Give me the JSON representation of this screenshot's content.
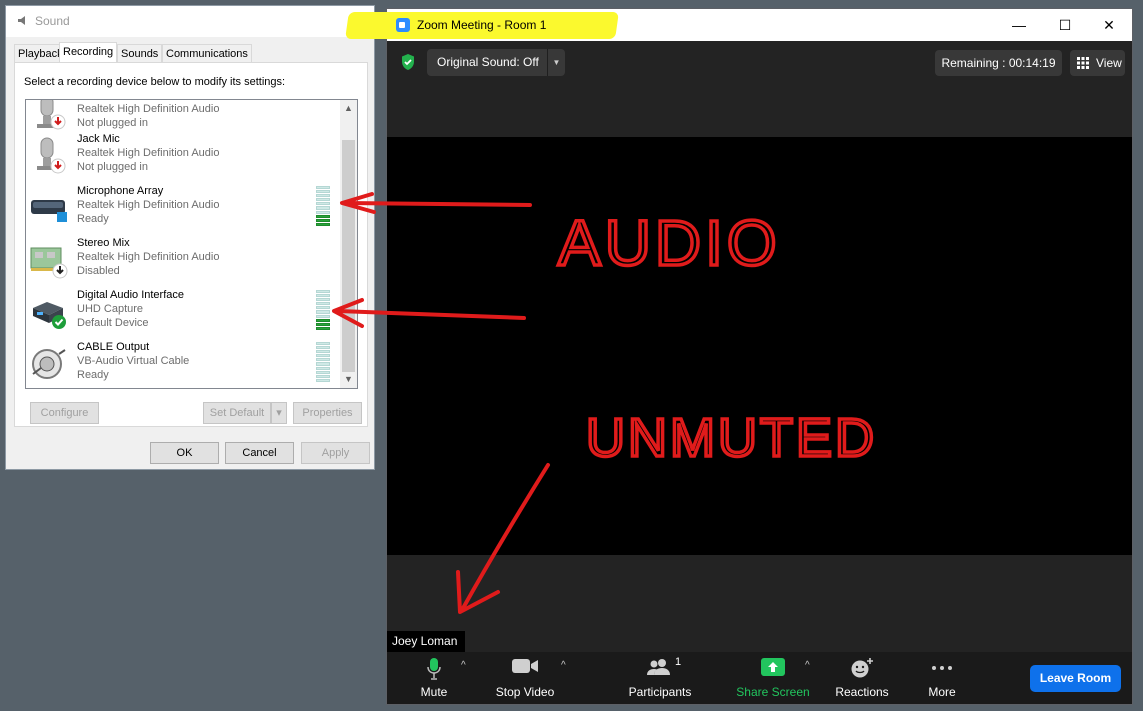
{
  "sound_dialog": {
    "title": "Sound",
    "close_glyph": "✕",
    "tabs": [
      "Playback",
      "Recording",
      "Sounds",
      "Communications"
    ],
    "active_tab": "Recording",
    "instruction": "Select a recording device below to modify its settings:",
    "devices": [
      {
        "name": "",
        "driver": "Realtek High Definition Audio",
        "status": "Not plugged in",
        "icon": "microphone-icon",
        "badge": "unplugged",
        "meter_level": null
      },
      {
        "name": "Jack Mic",
        "driver": "Realtek High Definition Audio",
        "status": "Not plugged in",
        "icon": "microphone-icon",
        "badge": "unplugged",
        "meter_level": null
      },
      {
        "name": "Microphone Array",
        "driver": "Realtek High Definition Audio",
        "status": "Ready",
        "icon": "microphone-array-icon",
        "badge": null,
        "meter_level": 0.3
      },
      {
        "name": "Stereo Mix",
        "driver": "Realtek High Definition Audio",
        "status": "Disabled",
        "icon": "sound-card-icon",
        "badge": "disabled",
        "meter_level": null
      },
      {
        "name": "Digital Audio Interface",
        "driver": "UHD Capture",
        "status": "Default Device",
        "icon": "audio-interface-icon",
        "badge": "default",
        "meter_level": 0.3
      },
      {
        "name": "CABLE Output",
        "driver": "VB-Audio Virtual Cable",
        "status": "Ready",
        "icon": "virtual-cable-icon",
        "badge": null,
        "meter_level": 0
      }
    ],
    "buttons": {
      "configure": "Configure",
      "set_default": "Set Default",
      "properties": "Properties",
      "ok": "OK",
      "cancel": "Cancel",
      "apply": "Apply"
    }
  },
  "zoom": {
    "title": "Zoom Meeting - Room 1",
    "window_controls": {
      "minimize": "—",
      "maximize": "☐",
      "close": "✕"
    },
    "original_sound": "Original Sound: Off",
    "remaining": "Remaining : 00:14:19",
    "view": "View",
    "participant_name": "Joey Loman",
    "toolbar": {
      "mute": "Mute",
      "stop_video": "Stop Video",
      "participants": "Participants",
      "participants_count": "1",
      "share_screen": "Share Screen",
      "reactions": "Reactions",
      "more": "More",
      "leave": "Leave Room"
    },
    "colors": {
      "accent": "#0e71eb",
      "share_green": "#22c55e",
      "highlight": "#fbf92e"
    }
  },
  "annotations": {
    "audio": "AUDIO",
    "unmuted": "UNMUTED",
    "color": "#e01b1b"
  }
}
